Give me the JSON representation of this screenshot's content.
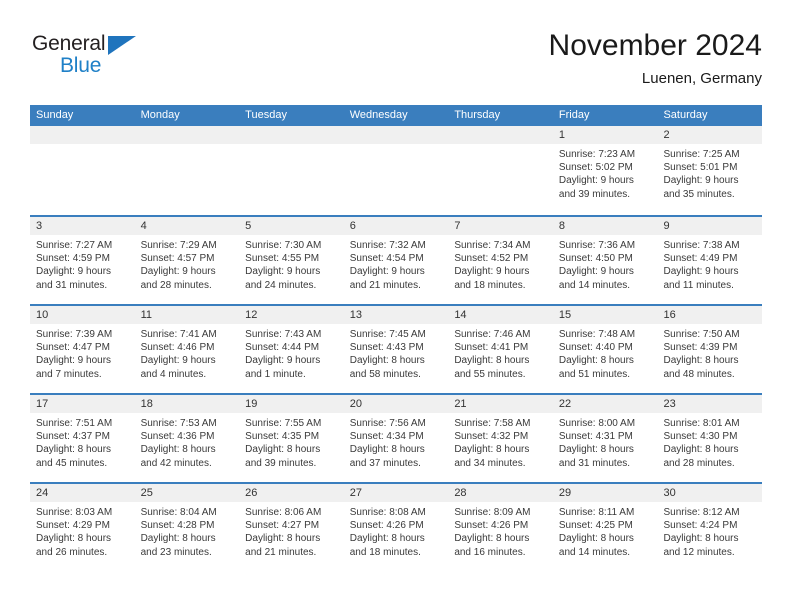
{
  "brand": {
    "line1": "General",
    "line2": "Blue",
    "triangle_color": "#1f74bd",
    "line2_color": "#1f80c7"
  },
  "header": {
    "title": "November 2024",
    "subtitle": "Luenen, Germany"
  },
  "theme": {
    "header_bar": "#3a7ebe",
    "day_band": "#f0f0f0",
    "text": "#3a3a3a"
  },
  "weekdays": [
    "Sunday",
    "Monday",
    "Tuesday",
    "Wednesday",
    "Thursday",
    "Friday",
    "Saturday"
  ],
  "weeks": [
    [
      {
        "day": "",
        "empty": true
      },
      {
        "day": "",
        "empty": true
      },
      {
        "day": "",
        "empty": true
      },
      {
        "day": "",
        "empty": true
      },
      {
        "day": "",
        "empty": true
      },
      {
        "day": "1",
        "sunrise": "Sunrise: 7:23 AM",
        "sunset": "Sunset: 5:02 PM",
        "daylight1": "Daylight: 9 hours",
        "daylight2": "and 39 minutes."
      },
      {
        "day": "2",
        "sunrise": "Sunrise: 7:25 AM",
        "sunset": "Sunset: 5:01 PM",
        "daylight1": "Daylight: 9 hours",
        "daylight2": "and 35 minutes."
      }
    ],
    [
      {
        "day": "3",
        "sunrise": "Sunrise: 7:27 AM",
        "sunset": "Sunset: 4:59 PM",
        "daylight1": "Daylight: 9 hours",
        "daylight2": "and 31 minutes."
      },
      {
        "day": "4",
        "sunrise": "Sunrise: 7:29 AM",
        "sunset": "Sunset: 4:57 PM",
        "daylight1": "Daylight: 9 hours",
        "daylight2": "and 28 minutes."
      },
      {
        "day": "5",
        "sunrise": "Sunrise: 7:30 AM",
        "sunset": "Sunset: 4:55 PM",
        "daylight1": "Daylight: 9 hours",
        "daylight2": "and 24 minutes."
      },
      {
        "day": "6",
        "sunrise": "Sunrise: 7:32 AM",
        "sunset": "Sunset: 4:54 PM",
        "daylight1": "Daylight: 9 hours",
        "daylight2": "and 21 minutes."
      },
      {
        "day": "7",
        "sunrise": "Sunrise: 7:34 AM",
        "sunset": "Sunset: 4:52 PM",
        "daylight1": "Daylight: 9 hours",
        "daylight2": "and 18 minutes."
      },
      {
        "day": "8",
        "sunrise": "Sunrise: 7:36 AM",
        "sunset": "Sunset: 4:50 PM",
        "daylight1": "Daylight: 9 hours",
        "daylight2": "and 14 minutes."
      },
      {
        "day": "9",
        "sunrise": "Sunrise: 7:38 AM",
        "sunset": "Sunset: 4:49 PM",
        "daylight1": "Daylight: 9 hours",
        "daylight2": "and 11 minutes."
      }
    ],
    [
      {
        "day": "10",
        "sunrise": "Sunrise: 7:39 AM",
        "sunset": "Sunset: 4:47 PM",
        "daylight1": "Daylight: 9 hours",
        "daylight2": "and 7 minutes."
      },
      {
        "day": "11",
        "sunrise": "Sunrise: 7:41 AM",
        "sunset": "Sunset: 4:46 PM",
        "daylight1": "Daylight: 9 hours",
        "daylight2": "and 4 minutes."
      },
      {
        "day": "12",
        "sunrise": "Sunrise: 7:43 AM",
        "sunset": "Sunset: 4:44 PM",
        "daylight1": "Daylight: 9 hours",
        "daylight2": "and 1 minute."
      },
      {
        "day": "13",
        "sunrise": "Sunrise: 7:45 AM",
        "sunset": "Sunset: 4:43 PM",
        "daylight1": "Daylight: 8 hours",
        "daylight2": "and 58 minutes."
      },
      {
        "day": "14",
        "sunrise": "Sunrise: 7:46 AM",
        "sunset": "Sunset: 4:41 PM",
        "daylight1": "Daylight: 8 hours",
        "daylight2": "and 55 minutes."
      },
      {
        "day": "15",
        "sunrise": "Sunrise: 7:48 AM",
        "sunset": "Sunset: 4:40 PM",
        "daylight1": "Daylight: 8 hours",
        "daylight2": "and 51 minutes."
      },
      {
        "day": "16",
        "sunrise": "Sunrise: 7:50 AM",
        "sunset": "Sunset: 4:39 PM",
        "daylight1": "Daylight: 8 hours",
        "daylight2": "and 48 minutes."
      }
    ],
    [
      {
        "day": "17",
        "sunrise": "Sunrise: 7:51 AM",
        "sunset": "Sunset: 4:37 PM",
        "daylight1": "Daylight: 8 hours",
        "daylight2": "and 45 minutes."
      },
      {
        "day": "18",
        "sunrise": "Sunrise: 7:53 AM",
        "sunset": "Sunset: 4:36 PM",
        "daylight1": "Daylight: 8 hours",
        "daylight2": "and 42 minutes."
      },
      {
        "day": "19",
        "sunrise": "Sunrise: 7:55 AM",
        "sunset": "Sunset: 4:35 PM",
        "daylight1": "Daylight: 8 hours",
        "daylight2": "and 39 minutes."
      },
      {
        "day": "20",
        "sunrise": "Sunrise: 7:56 AM",
        "sunset": "Sunset: 4:34 PM",
        "daylight1": "Daylight: 8 hours",
        "daylight2": "and 37 minutes."
      },
      {
        "day": "21",
        "sunrise": "Sunrise: 7:58 AM",
        "sunset": "Sunset: 4:32 PM",
        "daylight1": "Daylight: 8 hours",
        "daylight2": "and 34 minutes."
      },
      {
        "day": "22",
        "sunrise": "Sunrise: 8:00 AM",
        "sunset": "Sunset: 4:31 PM",
        "daylight1": "Daylight: 8 hours",
        "daylight2": "and 31 minutes."
      },
      {
        "day": "23",
        "sunrise": "Sunrise: 8:01 AM",
        "sunset": "Sunset: 4:30 PM",
        "daylight1": "Daylight: 8 hours",
        "daylight2": "and 28 minutes."
      }
    ],
    [
      {
        "day": "24",
        "sunrise": "Sunrise: 8:03 AM",
        "sunset": "Sunset: 4:29 PM",
        "daylight1": "Daylight: 8 hours",
        "daylight2": "and 26 minutes."
      },
      {
        "day": "25",
        "sunrise": "Sunrise: 8:04 AM",
        "sunset": "Sunset: 4:28 PM",
        "daylight1": "Daylight: 8 hours",
        "daylight2": "and 23 minutes."
      },
      {
        "day": "26",
        "sunrise": "Sunrise: 8:06 AM",
        "sunset": "Sunset: 4:27 PM",
        "daylight1": "Daylight: 8 hours",
        "daylight2": "and 21 minutes."
      },
      {
        "day": "27",
        "sunrise": "Sunrise: 8:08 AM",
        "sunset": "Sunset: 4:26 PM",
        "daylight1": "Daylight: 8 hours",
        "daylight2": "and 18 minutes."
      },
      {
        "day": "28",
        "sunrise": "Sunrise: 8:09 AM",
        "sunset": "Sunset: 4:26 PM",
        "daylight1": "Daylight: 8 hours",
        "daylight2": "and 16 minutes."
      },
      {
        "day": "29",
        "sunrise": "Sunrise: 8:11 AM",
        "sunset": "Sunset: 4:25 PM",
        "daylight1": "Daylight: 8 hours",
        "daylight2": "and 14 minutes."
      },
      {
        "day": "30",
        "sunrise": "Sunrise: 8:12 AM",
        "sunset": "Sunset: 4:24 PM",
        "daylight1": "Daylight: 8 hours",
        "daylight2": "and 12 minutes."
      }
    ]
  ]
}
